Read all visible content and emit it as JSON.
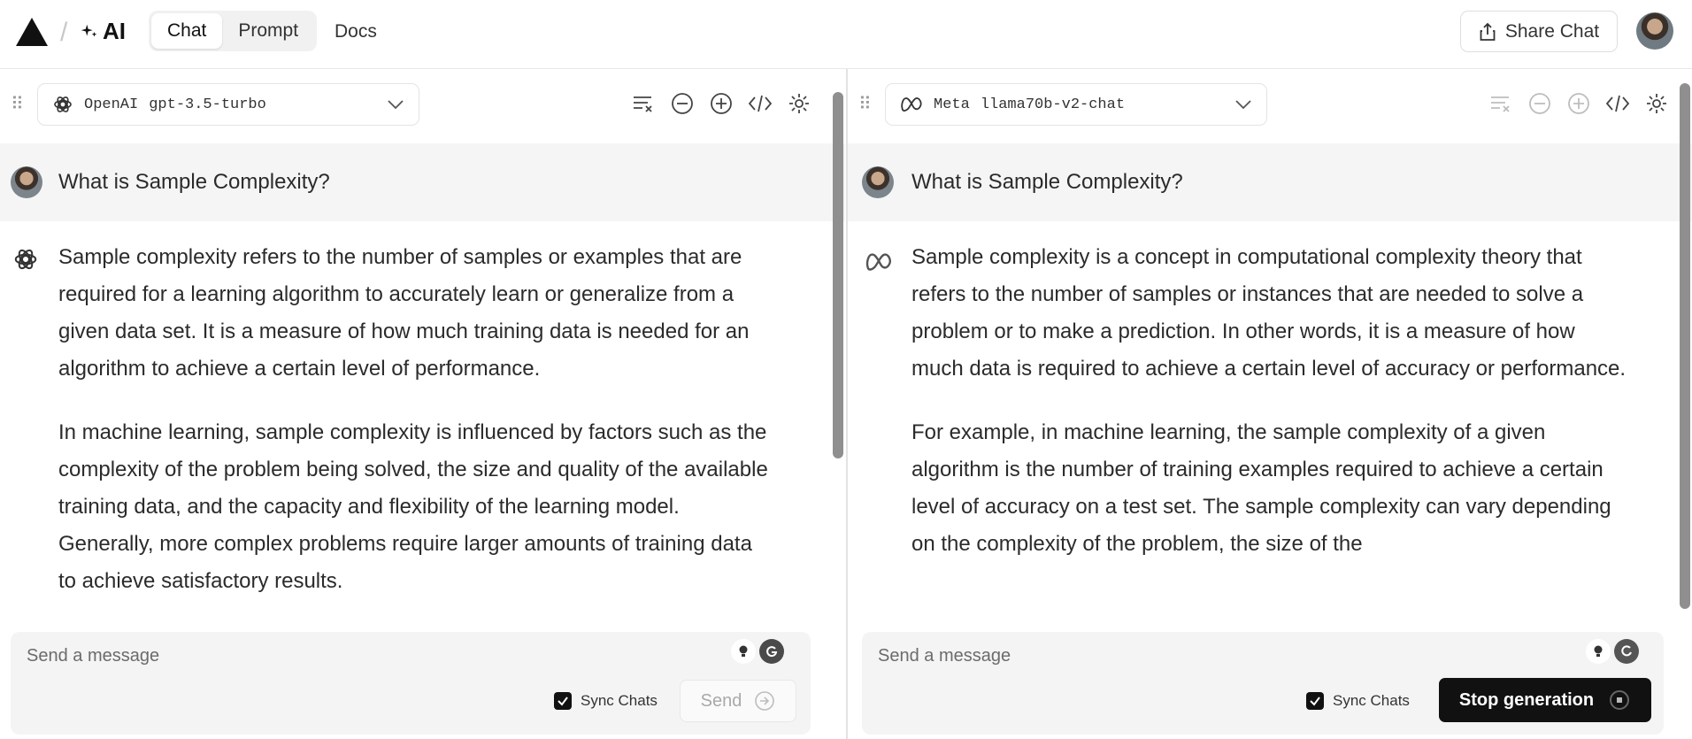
{
  "header": {
    "ai_label": "AI",
    "tabs": [
      {
        "label": "Chat"
      },
      {
        "label": "Prompt"
      }
    ],
    "docs_label": "Docs",
    "share_label": "Share Chat"
  },
  "left": {
    "provider": "OpenAI",
    "model": "gpt-3.5-turbo",
    "user_message": "What is Sample Complexity?",
    "answer": [
      "Sample complexity refers to the number of samples or examples that are required for a learning algorithm to accurately learn or generalize from a given data set. It is a measure of how much training data is needed for an algorithm to achieve a certain level of performance.",
      "In machine learning, sample complexity is influenced by factors such as the complexity of the problem being solved, the size and quality of the available training data, and the capacity and flexibility of the learning model. Generally, more complex problems require larger amounts of training data to achieve satisfactory results."
    ],
    "placeholder": "Send a message",
    "sync_label": "Sync Chats",
    "send_label": "Send"
  },
  "right": {
    "provider": "Meta",
    "model": "llama70b-v2-chat",
    "user_message": "What is Sample Complexity?",
    "answer": [
      "Sample complexity is a concept in computational complexity theory that refers to the number of samples or instances that are needed to solve a problem or to make a prediction. In other words, it is a measure of how much data is required to achieve a certain level of accuracy or performance.",
      "For example, in machine learning, the sample complexity of a given algorithm is the number of training examples required to achieve a certain level of accuracy on a test set. The sample complexity can vary depending on the complexity of the problem, the size of the"
    ],
    "placeholder": "Send a message",
    "sync_label": "Sync Chats",
    "stop_label": "Stop generation"
  }
}
